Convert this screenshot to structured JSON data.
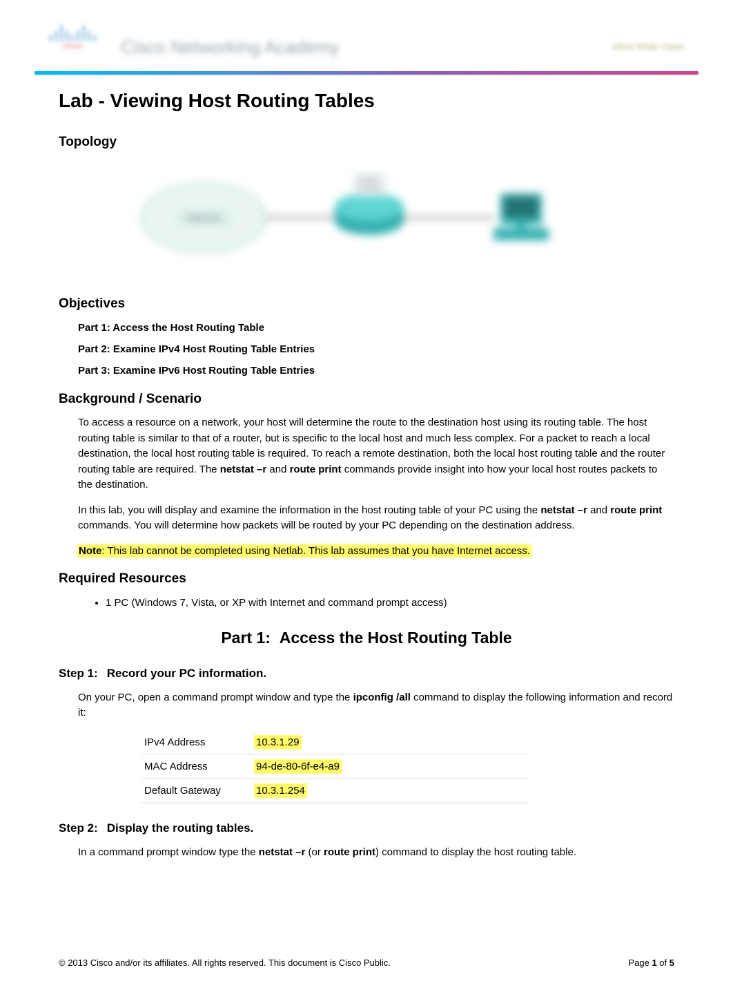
{
  "header": {
    "logo_text": "cisco",
    "academy_label": "Cisco Networking Academy",
    "tagline": "Mind Wide Open"
  },
  "title": "Lab - Viewing Host Routing Tables",
  "sections": {
    "topology": "Topology",
    "objectives": "Objectives",
    "background": "Background / Scenario",
    "required": "Required Resources"
  },
  "objectives": {
    "part1": "Part 1: Access the Host Routing Table",
    "part2": "Part 2: Examine IPv4 Host Routing Table Entries",
    "part3": "Part 3: Examine IPv6 Host Routing Table Entries"
  },
  "background": {
    "p1a": "To access a resource on a network, your host will determine the route to the destination host using its routing table. The host routing table is similar to that of a router, but is specific to the local host and much less complex. For a packet to reach a local destination, the local host routing table is required. To reach a remote destination, both the local host routing table and the router routing table are required. The ",
    "p1b": "netstat –r",
    "p1c": " and ",
    "p1d": "route print",
    "p1e": " commands provide insight into how your local host routes packets to the destination.",
    "p2a": "In this lab, you will display and examine the information in the host routing table of your PC using the ",
    "p2b": "netstat –r",
    "p2c": " and ",
    "p2d": "route print",
    "p2e": " commands. You will determine how packets will be routed by your PC depending on the destination address.",
    "note_label": "Note",
    "note_text": ": This lab cannot be completed using Netlab. This lab assumes that you have Internet access."
  },
  "resources": {
    "item1": "1 PC (Windows 7, Vista, or XP with Internet and command prompt access)"
  },
  "part1_heading": {
    "label": "Part 1:",
    "text": "Access the Host Routing Table"
  },
  "step1": {
    "label": "Step 1:",
    "title": "Record your PC information.",
    "p1a": "On your PC, open a command prompt window and type the ",
    "p1b": "ipconfig /all",
    "p1c": " command to display the following information and record it:"
  },
  "pc_info": {
    "ipv4_label": "IPv4 Address",
    "ipv4_value": "10.3.1.29",
    "mac_label": "MAC Address",
    "mac_value": "94-de-80-6f-e4-a9",
    "gateway_label": "Default Gateway",
    "gateway_value": "10.3.1.254"
  },
  "step2": {
    "label": "Step 2:",
    "title": "Display the routing tables.",
    "p1a": "In a command prompt window type the ",
    "p1b": "netstat –r",
    "p1c": " (or ",
    "p1d": "route print",
    "p1e": ") command to display the host routing table."
  },
  "topology_labels": {
    "cloud": "Internet",
    "router": "Default Gateway"
  },
  "footer": {
    "copyright": "© 2013 Cisco and/or its affiliates. All rights reserved. This document is Cisco Public.",
    "page_prefix": "Page ",
    "page_current": "1",
    "page_of": " of ",
    "page_total": "5"
  }
}
